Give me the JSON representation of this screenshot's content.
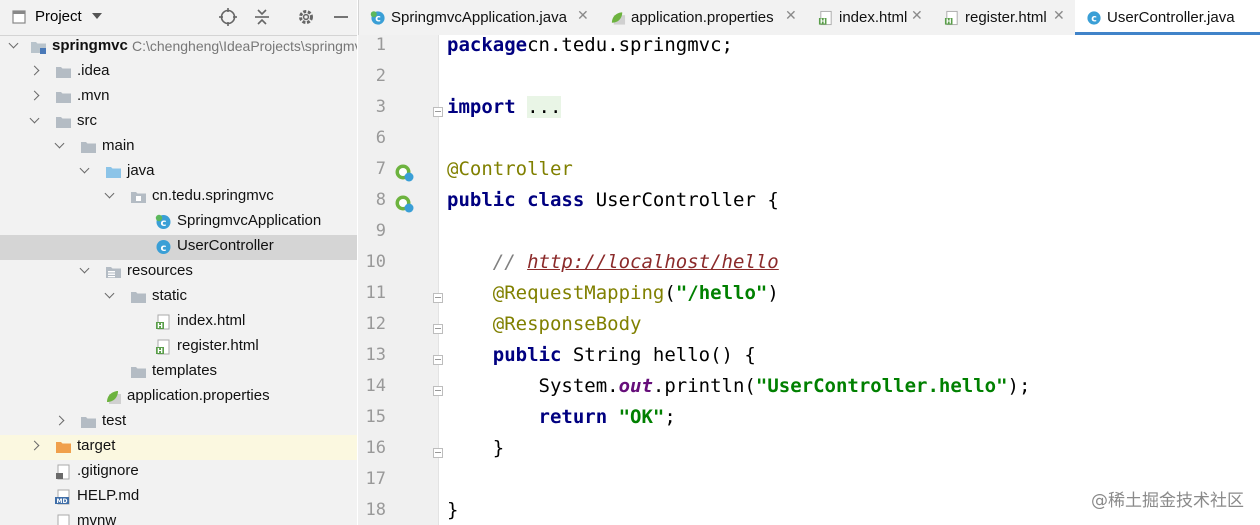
{
  "project_panel": {
    "title": "Project",
    "tree": [
      {
        "label": "springmvc",
        "path": "C:\\chengheng\\IdeaProjects\\springmvc",
        "bold": true,
        "icon": "module-folder-icon",
        "expanded": true
      },
      {
        "label": ".idea",
        "icon": "folder-icon",
        "expanded": false
      },
      {
        "label": ".mvn",
        "icon": "folder-icon",
        "expanded": false
      },
      {
        "label": "src",
        "icon": "folder-icon",
        "expanded": true
      },
      {
        "label": "main",
        "icon": "folder-icon",
        "expanded": true
      },
      {
        "label": "java",
        "icon": "source-folder-icon",
        "expanded": true
      },
      {
        "label": "cn.tedu.springmvc",
        "icon": "package-icon",
        "expanded": true
      },
      {
        "label": "SpringmvcApplication",
        "icon": "spring-boot-class-icon"
      },
      {
        "label": "UserController",
        "icon": "class-icon"
      },
      {
        "label": "resources",
        "icon": "resources-folder-icon",
        "expanded": true
      },
      {
        "label": "static",
        "icon": "folder-icon",
        "expanded": true
      },
      {
        "label": "index.html",
        "icon": "html-file-icon"
      },
      {
        "label": "register.html",
        "icon": "html-file-icon"
      },
      {
        "label": "templates",
        "icon": "folder-icon"
      },
      {
        "label": "application.properties",
        "icon": "spring-properties-icon"
      },
      {
        "label": "test",
        "icon": "folder-icon",
        "expanded": false
      },
      {
        "label": "target",
        "icon": "excluded-folder-icon",
        "expanded": false
      },
      {
        "label": ".gitignore",
        "icon": "gitignore-file-icon"
      },
      {
        "label": "HELP.md",
        "icon": "markdown-file-icon"
      },
      {
        "label": "mvnw",
        "icon": "file-icon"
      }
    ]
  },
  "tabs": [
    {
      "label": "SpringmvcApplication.java",
      "icon": "spring-boot-class-icon",
      "active": false
    },
    {
      "label": "application.properties",
      "icon": "spring-properties-icon",
      "active": false
    },
    {
      "label": "index.html",
      "icon": "html-file-icon",
      "active": false
    },
    {
      "label": "register.html",
      "icon": "html-file-icon",
      "active": false
    },
    {
      "label": "UserController.java",
      "icon": "class-icon",
      "active": true
    }
  ],
  "editor": {
    "lines": [
      {
        "number": "1",
        "tokens": [
          [
            "kw",
            "package"
          ],
          [
            "",
            "cn.tedu.springmvc;"
          ]
        ]
      },
      {
        "number": "2",
        "tokens": []
      },
      {
        "number": "3",
        "tokens": [
          [
            "kw",
            "import"
          ],
          [
            "",
            " "
          ],
          [
            "fldd",
            "..."
          ]
        ]
      },
      {
        "number": "6",
        "tokens": []
      },
      {
        "number": "7",
        "tokens": [
          [
            "ann",
            "@Controller"
          ]
        ]
      },
      {
        "number": "8",
        "tokens": [
          [
            "kw",
            "public"
          ],
          [
            "",
            " "
          ],
          [
            "kw",
            "class"
          ],
          [
            "",
            " UserController {"
          ]
        ]
      },
      {
        "number": "9",
        "tokens": []
      },
      {
        "number": "10",
        "tokens": [
          [
            "",
            "    "
          ],
          [
            "cmt",
            "// "
          ],
          [
            "url",
            "http://localhost/hello"
          ]
        ]
      },
      {
        "number": "11",
        "tokens": [
          [
            "",
            "    "
          ],
          [
            "ann",
            "@RequestMapping"
          ],
          [
            "",
            "("
          ],
          [
            "str",
            "\"/hello\""
          ],
          [
            "",
            ")"
          ]
        ]
      },
      {
        "number": "12",
        "tokens": [
          [
            "",
            "    "
          ],
          [
            "ann",
            "@ResponseBody"
          ]
        ]
      },
      {
        "number": "13",
        "tokens": [
          [
            "",
            "    "
          ],
          [
            "kw",
            "public"
          ],
          [
            "",
            " String hello() {"
          ]
        ]
      },
      {
        "number": "14",
        "tokens": [
          [
            "",
            "        System."
          ],
          [
            "fld",
            "out"
          ],
          [
            "",
            ".println("
          ],
          [
            "str",
            "\"UserController.hello\""
          ],
          [
            "",
            ");"
          ]
        ]
      },
      {
        "number": "15",
        "tokens": [
          [
            "",
            "        "
          ],
          [
            "kw",
            "return"
          ],
          [
            "",
            " "
          ],
          [
            "str",
            "\"OK\""
          ],
          [
            "",
            ";"
          ]
        ]
      },
      {
        "number": "16",
        "tokens": [
          [
            "",
            "    }"
          ]
        ]
      },
      {
        "number": "17",
        "tokens": []
      },
      {
        "number": "18",
        "tokens": [
          [
            "",
            "}"
          ]
        ]
      }
    ]
  },
  "watermark": "@稀土掘金技术社区",
  "colors": {
    "accent": "#4083c9",
    "keyword": "#000080",
    "annotation": "#808000",
    "string": "#008000"
  }
}
